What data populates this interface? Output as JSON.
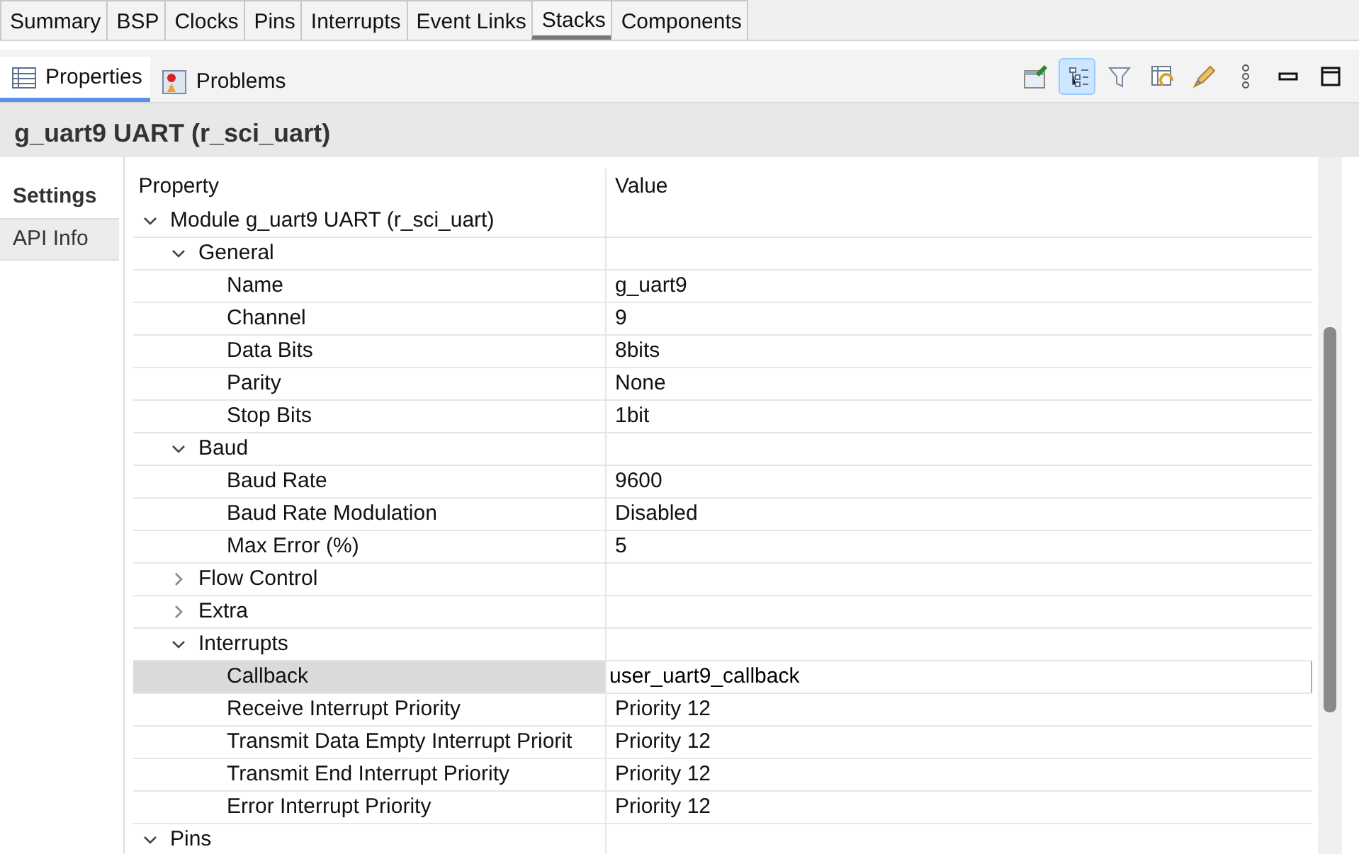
{
  "editor_tabs": [
    {
      "label": "Summary",
      "selected": false
    },
    {
      "label": "BSP",
      "selected": false
    },
    {
      "label": "Clocks",
      "selected": false
    },
    {
      "label": "Pins",
      "selected": false
    },
    {
      "label": "Interrupts",
      "selected": false
    },
    {
      "label": "Event Links",
      "selected": false
    },
    {
      "label": "Stacks",
      "selected": true
    },
    {
      "label": "Components",
      "selected": false
    }
  ],
  "view_tabs": [
    {
      "label": "Properties",
      "kind": "table",
      "selected": true
    },
    {
      "label": "Problems",
      "kind": "problems",
      "selected": false
    }
  ],
  "toolbar": [
    {
      "kind": "pin",
      "on": false
    },
    {
      "kind": "tree",
      "on": true
    },
    {
      "kind": "filter",
      "on": false
    },
    {
      "kind": "restore",
      "on": false
    },
    {
      "kind": "pen",
      "on": false
    },
    {
      "kind": "menu",
      "on": false
    },
    {
      "kind": "minimize",
      "on": false
    },
    {
      "kind": "maximize",
      "on": false
    }
  ],
  "title": "g_uart9 UART (r_sci_uart)",
  "side_tabs": [
    {
      "label": "Settings",
      "selected": true
    },
    {
      "label": "API Info",
      "selected": false
    }
  ],
  "table": {
    "columns": [
      "Property",
      "Value"
    ],
    "rows": [
      {
        "label": "Module g_uart9 UART (r_sci_uart)",
        "expanded": true,
        "children": [
          {
            "label": "General",
            "expanded": true,
            "children": [
              {
                "label": "Name",
                "value": "g_uart9"
              },
              {
                "label": "Channel",
                "value": "9"
              },
              {
                "label": "Data Bits",
                "value": "8bits"
              },
              {
                "label": "Parity",
                "value": "None"
              },
              {
                "label": "Stop Bits",
                "value": "1bit"
              }
            ]
          },
          {
            "label": "Baud",
            "expanded": true,
            "children": [
              {
                "label": "Baud Rate",
                "value": "9600"
              },
              {
                "label": "Baud Rate Modulation",
                "value": "Disabled"
              },
              {
                "label": "Max Error (%)",
                "value": "5"
              }
            ]
          },
          {
            "label": "Flow Control",
            "expanded": false
          },
          {
            "label": "Extra",
            "expanded": false
          },
          {
            "label": "Interrupts",
            "expanded": true,
            "children": [
              {
                "label": "Callback",
                "value": "user_uart9_callback",
                "selected": true,
                "editing": true
              },
              {
                "label": "Receive Interrupt Priority",
                "value": "Priority 12"
              },
              {
                "label": "Transmit Data Empty Interrupt Priorit",
                "value": "Priority 12"
              },
              {
                "label": "Transmit End Interrupt Priority",
                "value": "Priority 12"
              },
              {
                "label": "Error Interrupt Priority",
                "value": "Priority 12"
              }
            ]
          }
        ]
      },
      {
        "label": "Pins",
        "expanded": true
      }
    ]
  }
}
